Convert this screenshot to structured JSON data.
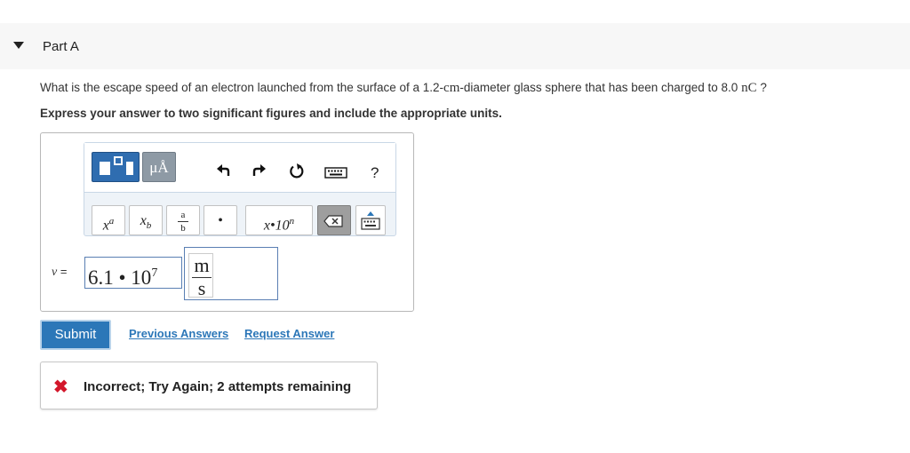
{
  "part": {
    "title": "Part A"
  },
  "question": {
    "text_before": "What is the escape speed of an electron launched from the surface of a 1.2-",
    "unit_cm": "cm",
    "text_middle": "-diameter glass sphere that has been charged to 8.0 ",
    "unit_nC": "nC",
    "text_after": " ?",
    "instruction": "Express your answer to two significant figures and include the appropriate units."
  },
  "toolbar": {
    "units_label": "μÅ",
    "help_label": "?",
    "keys": {
      "superscript": "xa",
      "subscript": "xb",
      "fraction_num": "a",
      "fraction_den": "b",
      "dot": "•",
      "sci_notation": "x•10n"
    },
    "icons": [
      "templates-icon",
      "units-icon",
      "undo-icon",
      "redo-icon",
      "reset-icon",
      "keyboard-icon",
      "help-icon",
      "backspace-icon",
      "keyboard-toggle-icon"
    ]
  },
  "answer": {
    "label_var": "v",
    "label_eq": " =",
    "mantissa": "6.1 • 10",
    "exponent": "7",
    "unit_numerator": "m",
    "unit_denominator": "s"
  },
  "actions": {
    "submit": "Submit",
    "previous_answers": "Previous Answers",
    "request_answer": "Request Answer"
  },
  "feedback": {
    "icon": "✖",
    "text": "Incorrect; Try Again; 2 attempts remaining"
  },
  "colors": {
    "accent": "#2c77b8",
    "error": "#d3172b",
    "template_button": "#2f6db0"
  }
}
